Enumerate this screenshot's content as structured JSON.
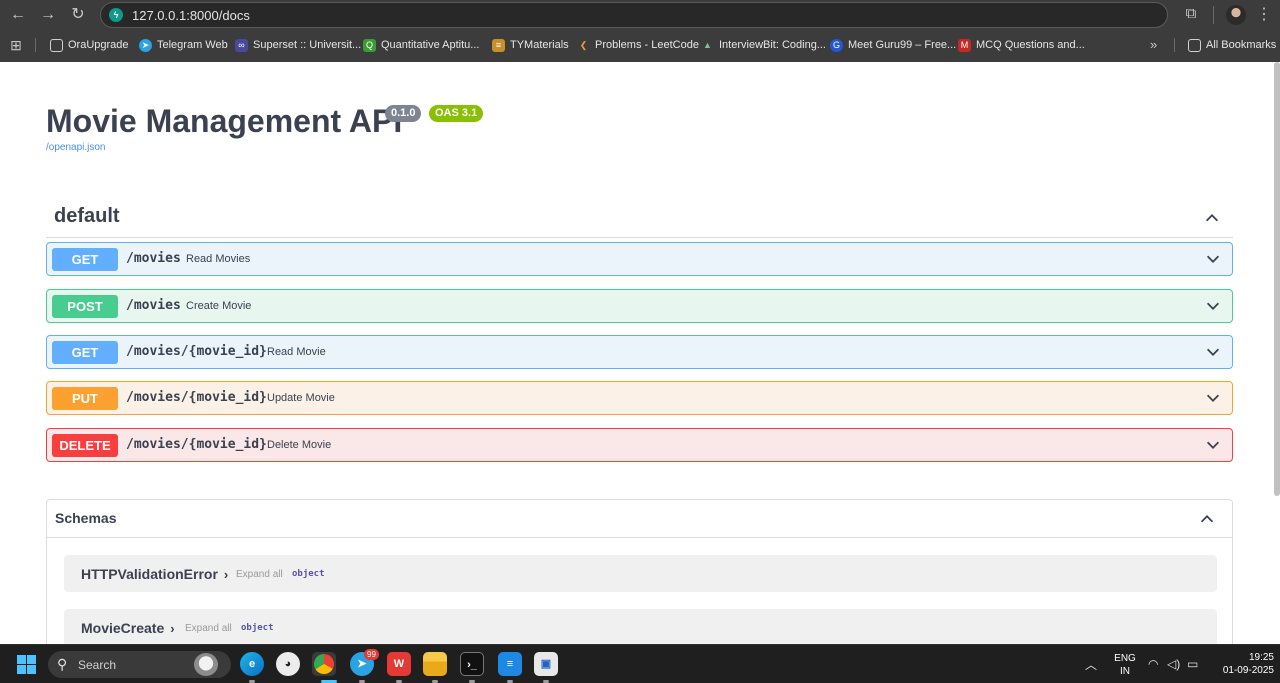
{
  "browser": {
    "url": "127.0.0.1:8000/docs",
    "bookmarks": [
      {
        "label": "OraUpgrade",
        "icon": "folder-icon"
      },
      {
        "label": "Telegram Web",
        "icon": "telegram-icon"
      },
      {
        "label": "Superset :: Universit...",
        "icon": "superset-icon"
      },
      {
        "label": "Quantitative Aptitu...",
        "icon": "indiabix-icon"
      },
      {
        "label": "TYMaterials",
        "icon": "tymaterials-icon"
      },
      {
        "label": "Problems - LeetCode",
        "icon": "leetcode-icon"
      },
      {
        "label": "InterviewBit: Coding...",
        "icon": "interviewbit-icon"
      },
      {
        "label": "Meet Guru99 – Free...",
        "icon": "guru99-icon"
      },
      {
        "label": "MCQ Questions and...",
        "icon": "mcq-icon"
      }
    ],
    "more_bookmarks": "»",
    "all_bookmarks": "All Bookmarks"
  },
  "api": {
    "title": "Movie Management API",
    "version": "0.1.0",
    "oas": "OAS 3.1",
    "spec_link": "/openapi.json"
  },
  "tag": {
    "name": "default"
  },
  "operations": [
    {
      "method": "GET",
      "path": "/movies",
      "summary": "Read Movies"
    },
    {
      "method": "POST",
      "path": "/movies",
      "summary": "Create Movie"
    },
    {
      "method": "GET",
      "path": "/movies/{movie_id}",
      "summary": "Read Movie"
    },
    {
      "method": "PUT",
      "path": "/movies/{movie_id}",
      "summary": "Update Movie"
    },
    {
      "method": "DELETE",
      "path": "/movies/{movie_id}",
      "summary": "Delete Movie"
    }
  ],
  "schemas": {
    "title": "Schemas",
    "models": [
      {
        "name": "HTTPValidationError",
        "expand": "Expand all",
        "type": "object"
      },
      {
        "name": "MovieCreate",
        "expand": "Expand all",
        "type": "object"
      }
    ]
  },
  "taskbar": {
    "search": "Search",
    "telegram_badge": "99",
    "lang_top": "ENG",
    "lang_bottom": "IN",
    "time": "19:25",
    "date": "01-09-2025"
  },
  "colors": {
    "get": "#61affe",
    "post": "#49cc90",
    "put": "#fca130",
    "delete": "#f93e3e",
    "oas_badge": "#89bf04",
    "version_badge": "#7d8492"
  }
}
